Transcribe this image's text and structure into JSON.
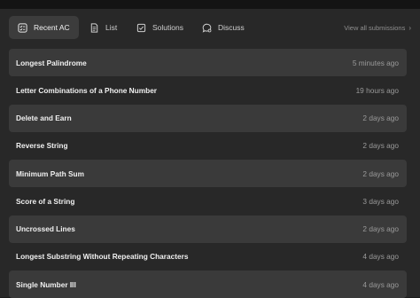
{
  "tabs": [
    {
      "label": "Recent AC",
      "icon": "checklist-icon",
      "active": true
    },
    {
      "label": "List",
      "icon": "document-icon",
      "active": false
    },
    {
      "label": "Solutions",
      "icon": "check-square-icon",
      "active": false
    },
    {
      "label": "Discuss",
      "icon": "chat-bubble-icon",
      "active": false
    }
  ],
  "view_all": {
    "label": "View all submissions",
    "icon": "chevron-right-icon"
  },
  "submissions": [
    {
      "title": "Longest Palindrome",
      "time": "5 minutes ago"
    },
    {
      "title": "Letter Combinations of a Phone Number",
      "time": "19 hours ago"
    },
    {
      "title": "Delete and Earn",
      "time": "2 days ago"
    },
    {
      "title": "Reverse String",
      "time": "2 days ago"
    },
    {
      "title": "Minimum Path Sum",
      "time": "2 days ago"
    },
    {
      "title": "Score of a String",
      "time": "3 days ago"
    },
    {
      "title": "Uncrossed Lines",
      "time": "2 days ago"
    },
    {
      "title": "Longest Substring Without Repeating Characters",
      "time": "4 days ago"
    },
    {
      "title": "Single Number III",
      "time": "4 days ago"
    }
  ],
  "colors": {
    "background": "#282828",
    "row_alt": "#3a3a3a",
    "tab_active": "#3c3c3c",
    "text_primary": "#f0f0f0",
    "text_muted": "#9a9a9a"
  }
}
